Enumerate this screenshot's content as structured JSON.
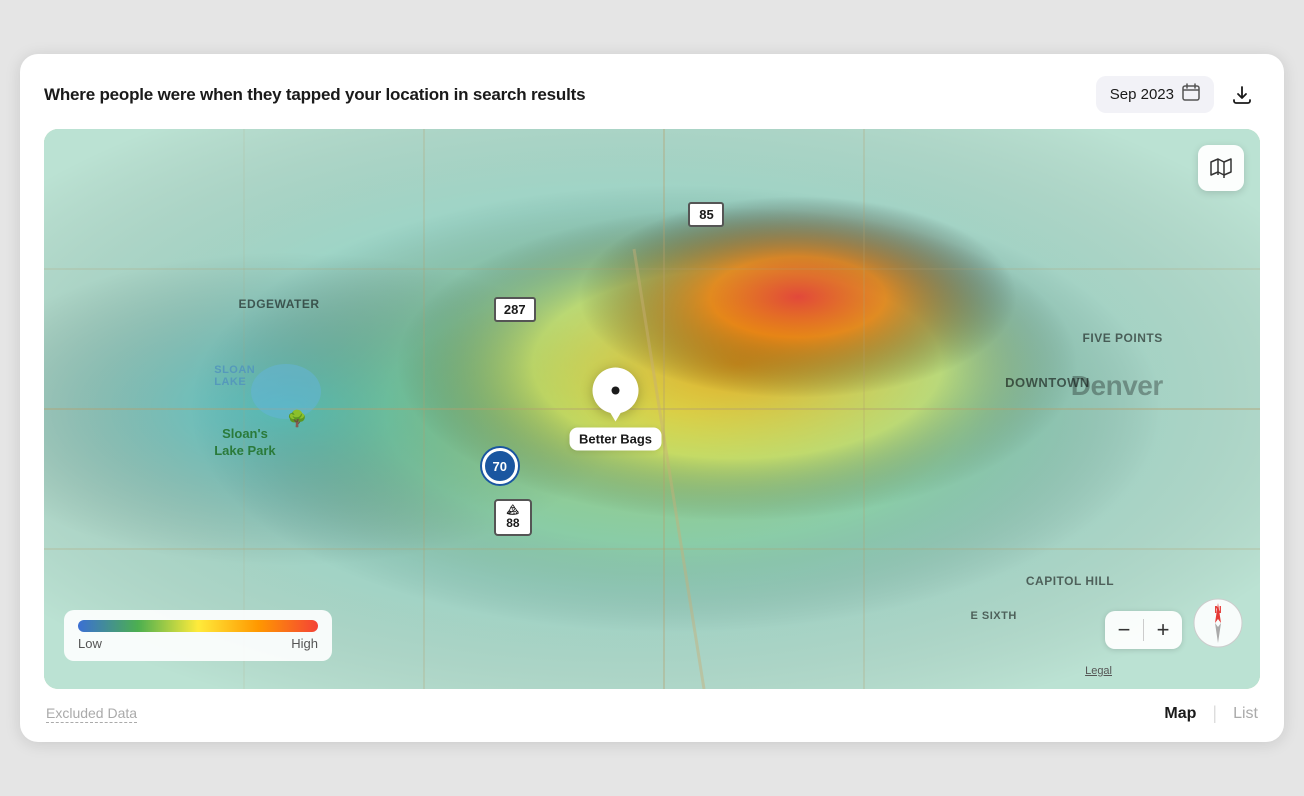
{
  "header": {
    "title": "Where people were when they tapped your location in search results",
    "date_label": "Sep 2023",
    "download_icon": "⬆",
    "calendar_icon": "📅"
  },
  "map": {
    "location_name": "Better Bags",
    "neighborhoods": {
      "downtown": "DOWNTOWN",
      "five_points": "FIVE POINTS",
      "capitol_hill": "CAPITOL HILL",
      "edgewater": "Edgewater",
      "denver": "Denver"
    },
    "places": {
      "sloans_lake": "Sloan\nLake",
      "sloans_lake_park": "Sloan's\nLake Park"
    },
    "roads": {
      "highway_85": "85",
      "highway_287": "287",
      "interstate_70": "70",
      "highway_88": "88",
      "street_e_sixth": "E SIXTH"
    },
    "legend": {
      "low_label": "Low",
      "high_label": "High"
    },
    "toggle_label": "🗺",
    "legal_label": "Legal",
    "compass_n": "N",
    "zoom_minus": "−",
    "zoom_plus": "+"
  },
  "footer": {
    "excluded_data_label": "Excluded Data",
    "view_map_label": "Map",
    "view_list_label": "List",
    "active_view": "map"
  }
}
